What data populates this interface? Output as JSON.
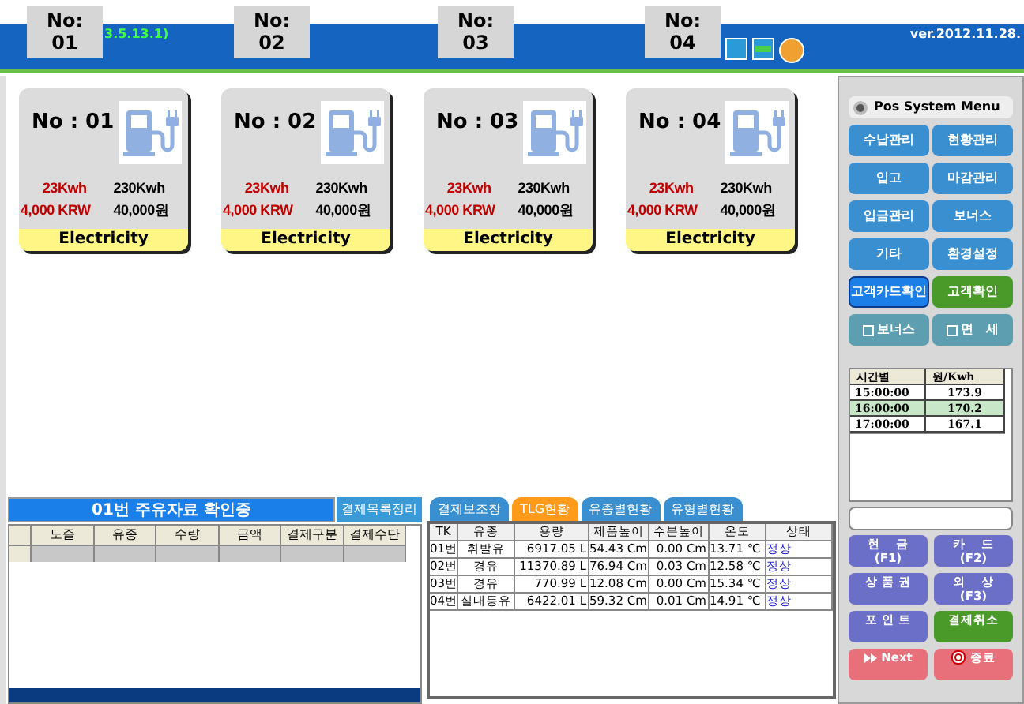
{
  "header": {
    "version_fragment": "3.5.13.1)",
    "version": "ver.2012.11.28.",
    "nozzle_tabs": [
      "No:\n01",
      "No:\n02",
      "No:\n03",
      "No:\n04"
    ]
  },
  "chargers": [
    {
      "title": "No : 01",
      "used_kwh": "23Kwh",
      "total_kwh": "230Kwh",
      "used_price": "4,000 KRW",
      "total_price": "40,000원",
      "type": "Electricity"
    },
    {
      "title": "No : 02",
      "used_kwh": "23Kwh",
      "total_kwh": "230Kwh",
      "used_price": "4,000 KRW",
      "total_price": "40,000원",
      "type": "Electricity"
    },
    {
      "title": "No : 03",
      "used_kwh": "23Kwh",
      "total_kwh": "230Kwh",
      "used_price": "4,000 KRW",
      "total_price": "40,000원",
      "type": "Electricity"
    },
    {
      "title": "No : 04",
      "used_kwh": "23Kwh",
      "total_kwh": "230Kwh",
      "used_price": "4,000 KRW",
      "total_price": "40,000원",
      "type": "Electricity"
    }
  ],
  "fuel_panel": {
    "title": "01번 주유자료 확인중",
    "button": "결제목록정리",
    "columns": [
      "노즐",
      "유종",
      "수량",
      "금액",
      "결제구분",
      "결제수단"
    ]
  },
  "tank_panel": {
    "tabs": [
      {
        "label": "결제보조창",
        "selected": false
      },
      {
        "label": "TLG현황",
        "selected": true
      },
      {
        "label": "유종별현황",
        "selected": false
      },
      {
        "label": "유형별현황",
        "selected": false
      }
    ],
    "columns": [
      "TK",
      "유종",
      "용량",
      "제품높이",
      "수분높이",
      "온도",
      "상태"
    ],
    "rows": [
      [
        "01번",
        "휘발유",
        "6917.05 L",
        "54.43 Cm",
        "0.00 Cm",
        "13.71 ℃",
        "정상"
      ],
      [
        "02번",
        "경유",
        "11370.89 L",
        "76.94 Cm",
        "0.03 Cm",
        "12.58 ℃",
        "정상"
      ],
      [
        "03번",
        "경유",
        "770.99 L",
        "12.08 Cm",
        "0.00 Cm",
        "15.34 ℃",
        "정상"
      ],
      [
        "04번",
        "실내등유",
        "6422.01 L",
        "59.32 Cm",
        "0.01 Cm",
        "14.91 ℃",
        "정상"
      ]
    ]
  },
  "menu": {
    "title": "Pos System Menu",
    "buttons": [
      {
        "label": "수납관리",
        "kind": "menu"
      },
      {
        "label": "현황관리",
        "kind": "menu"
      },
      {
        "label": "입고",
        "kind": "menu"
      },
      {
        "label": "마감관리",
        "kind": "menu"
      },
      {
        "label": "입금관리",
        "kind": "menu"
      },
      {
        "label": "보너스",
        "kind": "menu"
      },
      {
        "label": "기타",
        "kind": "menu"
      },
      {
        "label": "환경설정",
        "kind": "menu"
      },
      {
        "label": "고객카드확인",
        "kind": "card"
      },
      {
        "label": "고객확인",
        "kind": "customer"
      },
      {
        "label": "보너스",
        "kind": "check",
        "checked": false
      },
      {
        "label": "면   세",
        "kind": "check",
        "checked": false
      }
    ]
  },
  "rates": {
    "columns": [
      "시간별",
      "원/Kwh"
    ],
    "rows": [
      {
        "time": "15:00:00",
        "price": "173.9",
        "selected": false
      },
      {
        "time": "16:00:00",
        "price": "170.2",
        "selected": true
      },
      {
        "time": "17:00:00",
        "price": "167.1",
        "selected": false
      }
    ]
  },
  "payment_buttons": [
    {
      "label": "현    금",
      "key": "(F1)",
      "kind": "pay"
    },
    {
      "label": "카    드",
      "key": "(F2)",
      "kind": "pay"
    },
    {
      "label": "상 품 권",
      "kind": "pay"
    },
    {
      "label": "외    상",
      "key": "(F3)",
      "kind": "pay"
    },
    {
      "label": "포 인 트",
      "kind": "pay"
    },
    {
      "label": "결제취소",
      "kind": "cancel"
    },
    {
      "label": "Next",
      "kind": "next"
    },
    {
      "label": "종료",
      "kind": "exit"
    }
  ]
}
